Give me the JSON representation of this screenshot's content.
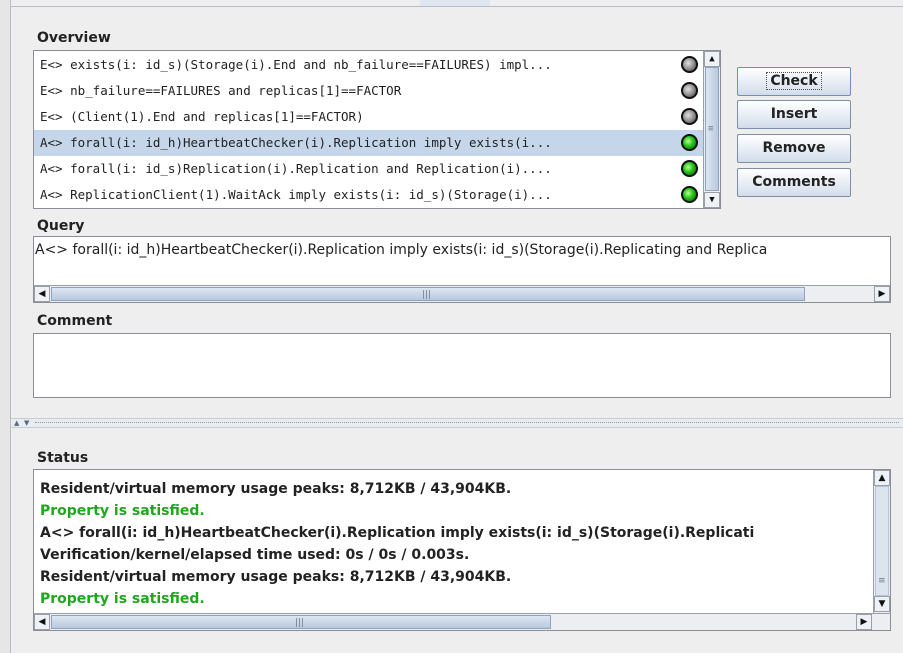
{
  "overview": {
    "label": "Overview",
    "rows": [
      {
        "text": "E<> exists(i: id_s)(Storage(i).End and nb_failure==FAILURES) impl...",
        "status": "grey",
        "selected": false
      },
      {
        "text": "E<> nb_failure==FAILURES and replicas[1]==FACTOR",
        "status": "grey",
        "selected": false
      },
      {
        "text": "E<> (Client(1).End and replicas[1]==FACTOR)",
        "status": "grey",
        "selected": false
      },
      {
        "text": "A<> forall(i: id_h)HeartbeatChecker(i).Replication imply exists(i...",
        "status": "green",
        "selected": true
      },
      {
        "text": "A<> forall(i: id_s)Replication(i).Replication and Replication(i)....",
        "status": "green",
        "selected": false
      },
      {
        "text": "A<> ReplicationClient(1).WaitAck imply exists(i: id_s)(Storage(i)...",
        "status": "green",
        "selected": false
      }
    ]
  },
  "buttons": {
    "check": "Check",
    "insert": "Insert",
    "remove": "Remove",
    "comments": "Comments"
  },
  "query": {
    "label": "Query",
    "text": "A<> forall(i: id_h)HeartbeatChecker(i).Replication imply exists(i: id_s)(Storage(i).Replicating and Replica"
  },
  "comment": {
    "label": "Comment",
    "text": ""
  },
  "status": {
    "label": "Status",
    "lines": [
      {
        "text": "Resident/virtual memory usage peaks: 8,712KB / 43,904KB.",
        "kind": "normal"
      },
      {
        "text": "Property is satisfied.",
        "kind": "ok"
      },
      {
        "text": "A<> forall(i: id_h)HeartbeatChecker(i).Replication imply exists(i: id_s)(Storage(i).Replicati",
        "kind": "normal"
      },
      {
        "text": "Verification/kernel/elapsed time used: 0s / 0s / 0.003s.",
        "kind": "normal"
      },
      {
        "text": "Resident/virtual memory usage peaks: 8,712KB / 43,904KB.",
        "kind": "normal"
      },
      {
        "text": "Property is satisfied.",
        "kind": "ok"
      }
    ]
  },
  "colors": {
    "satisfied_text": "#1ea71e",
    "selection": "#c6d6ea",
    "unchecked_dot": "#9a9a9a",
    "satisfied_dot": "#22c414"
  }
}
